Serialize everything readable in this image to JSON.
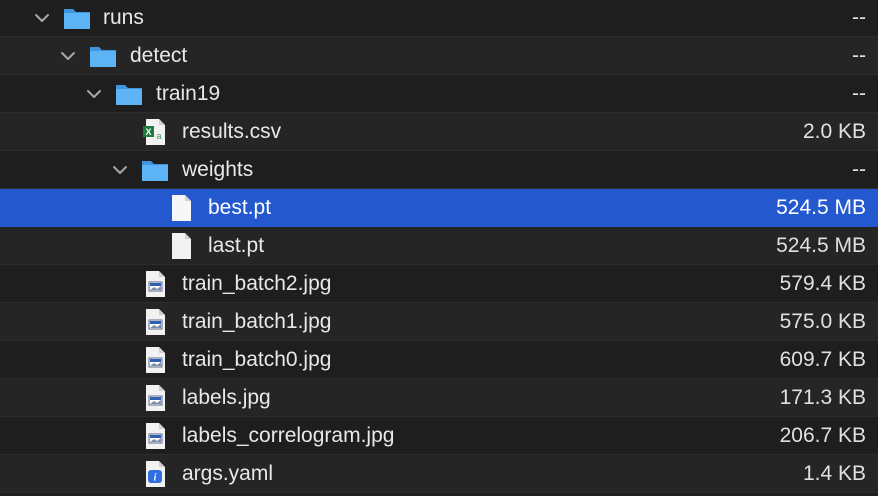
{
  "rows": [
    {
      "name": "runs",
      "size": "--",
      "icon": "folder-icon"
    },
    {
      "name": "detect",
      "size": "--",
      "icon": "folder-icon"
    },
    {
      "name": "train19",
      "size": "--",
      "icon": "folder-icon"
    },
    {
      "name": "results.csv",
      "size": "2.0 KB",
      "icon": "csv-file-icon"
    },
    {
      "name": "weights",
      "size": "--",
      "icon": "folder-icon"
    },
    {
      "name": "best.pt",
      "size": "524.5 MB",
      "icon": "blank-file-icon",
      "selected": true
    },
    {
      "name": "last.pt",
      "size": "524.5 MB",
      "icon": "blank-file-icon"
    },
    {
      "name": "train_batch2.jpg",
      "size": "579.4 KB",
      "icon": "image-file-icon"
    },
    {
      "name": "train_batch1.jpg",
      "size": "575.0 KB",
      "icon": "image-file-icon"
    },
    {
      "name": "train_batch0.jpg",
      "size": "609.7 KB",
      "icon": "image-file-icon"
    },
    {
      "name": "labels.jpg",
      "size": "171.3 KB",
      "icon": "image-file-icon"
    },
    {
      "name": "labels_correlogram.jpg",
      "size": "206.7 KB",
      "icon": "image-file-icon"
    },
    {
      "name": "args.yaml",
      "size": "1.4 KB",
      "icon": "yaml-file-icon"
    }
  ],
  "colors": {
    "background": "#1e1e1e",
    "selection": "#2458cf",
    "folder": "#4ba7f0",
    "text": "#e8e8e8"
  }
}
